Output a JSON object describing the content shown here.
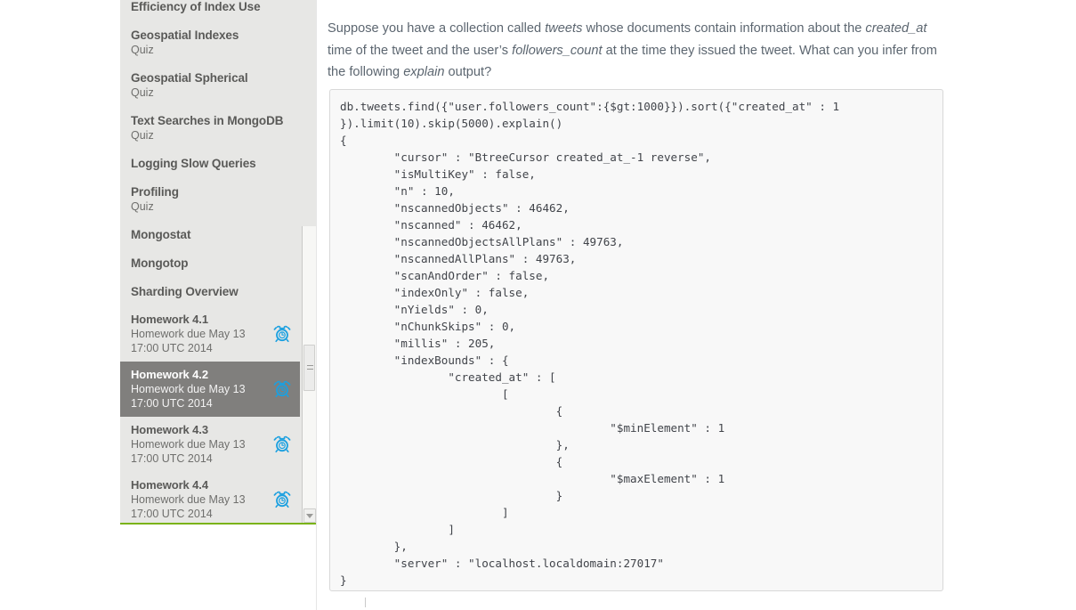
{
  "sidebar": {
    "syllabus_items": [
      {
        "title": "Efficiency of Index Use",
        "sub": ""
      },
      {
        "title": "Geospatial Indexes",
        "sub": "Quiz"
      },
      {
        "title": "Geospatial Spherical",
        "sub": "Quiz"
      },
      {
        "title": "Text Searches in MongoDB",
        "sub": "Quiz"
      },
      {
        "title": "Logging Slow Queries",
        "sub": ""
      },
      {
        "title": "Profiling",
        "sub": "Quiz"
      },
      {
        "title": "Mongostat",
        "sub": ""
      },
      {
        "title": "Mongotop",
        "sub": ""
      },
      {
        "title": "Sharding Overview",
        "sub": ""
      }
    ],
    "homework_items": [
      {
        "title": "Homework 4.1",
        "due_line1": "Homework due May 13",
        "due_line2": "17:00 UTC 2014",
        "icon": "alarm-clock-icon",
        "selected": false
      },
      {
        "title": "Homework 4.2",
        "due_line1": "Homework due May 13",
        "due_line2": "17:00 UTC 2014",
        "icon": "alarm-clock-icon",
        "selected": true
      },
      {
        "title": "Homework 4.3",
        "due_line1": "Homework due May 13",
        "due_line2": "17:00 UTC 2014",
        "icon": "alarm-clock-icon",
        "selected": false
      },
      {
        "title": "Homework 4.4",
        "due_line1": "Homework due May 13",
        "due_line2": "17:00 UTC 2014",
        "icon": "alarm-clock-icon",
        "selected": false
      }
    ],
    "scrollbar": {
      "down_arrow_icon": "chevron-down-icon"
    },
    "colors": {
      "background": "#e7e7e5",
      "selected_background": "#807f7d",
      "bottom_accent": "#7ab317",
      "alarm_icon": "#1ba0e0"
    }
  },
  "main": {
    "question_parts": [
      {
        "text": "Suppose you have a collection called ",
        "italic": false
      },
      {
        "text": "tweets",
        "italic": true
      },
      {
        "text": " whose documents contain information about the ",
        "italic": false
      },
      {
        "text": "created_at",
        "italic": true
      },
      {
        "text": " time of the tweet and the user’s ",
        "italic": false
      },
      {
        "text": "followers_count",
        "italic": true
      },
      {
        "text": " at the time they issued the tweet. What can you infer from the following ",
        "italic": false
      },
      {
        "text": "explain",
        "italic": true
      },
      {
        "text": " output?",
        "italic": false
      }
    ],
    "code": "db.tweets.find({\"user.followers_count\":{$gt:1000}}).sort({\"created_at\" : 1\n}).limit(10).skip(5000).explain()\n{\n        \"cursor\" : \"BtreeCursor created_at_-1 reverse\",\n        \"isMultiKey\" : false,\n        \"n\" : 10,\n        \"nscannedObjects\" : 46462,\n        \"nscanned\" : 46462,\n        \"nscannedObjectsAllPlans\" : 49763,\n        \"nscannedAllPlans\" : 49763,\n        \"scanAndOrder\" : false,\n        \"indexOnly\" : false,\n        \"nYields\" : 0,\n        \"nChunkSkips\" : 0,\n        \"millis\" : 205,\n        \"indexBounds\" : {\n                \"created_at\" : [\n                        [\n                                {\n                                        \"$minElement\" : 1\n                                },\n                                {\n                                        \"$maxElement\" : 1\n                                }\n                        ]\n                ]\n        },\n        \"server\" : \"localhost.localdomain:27017\"\n}"
  }
}
